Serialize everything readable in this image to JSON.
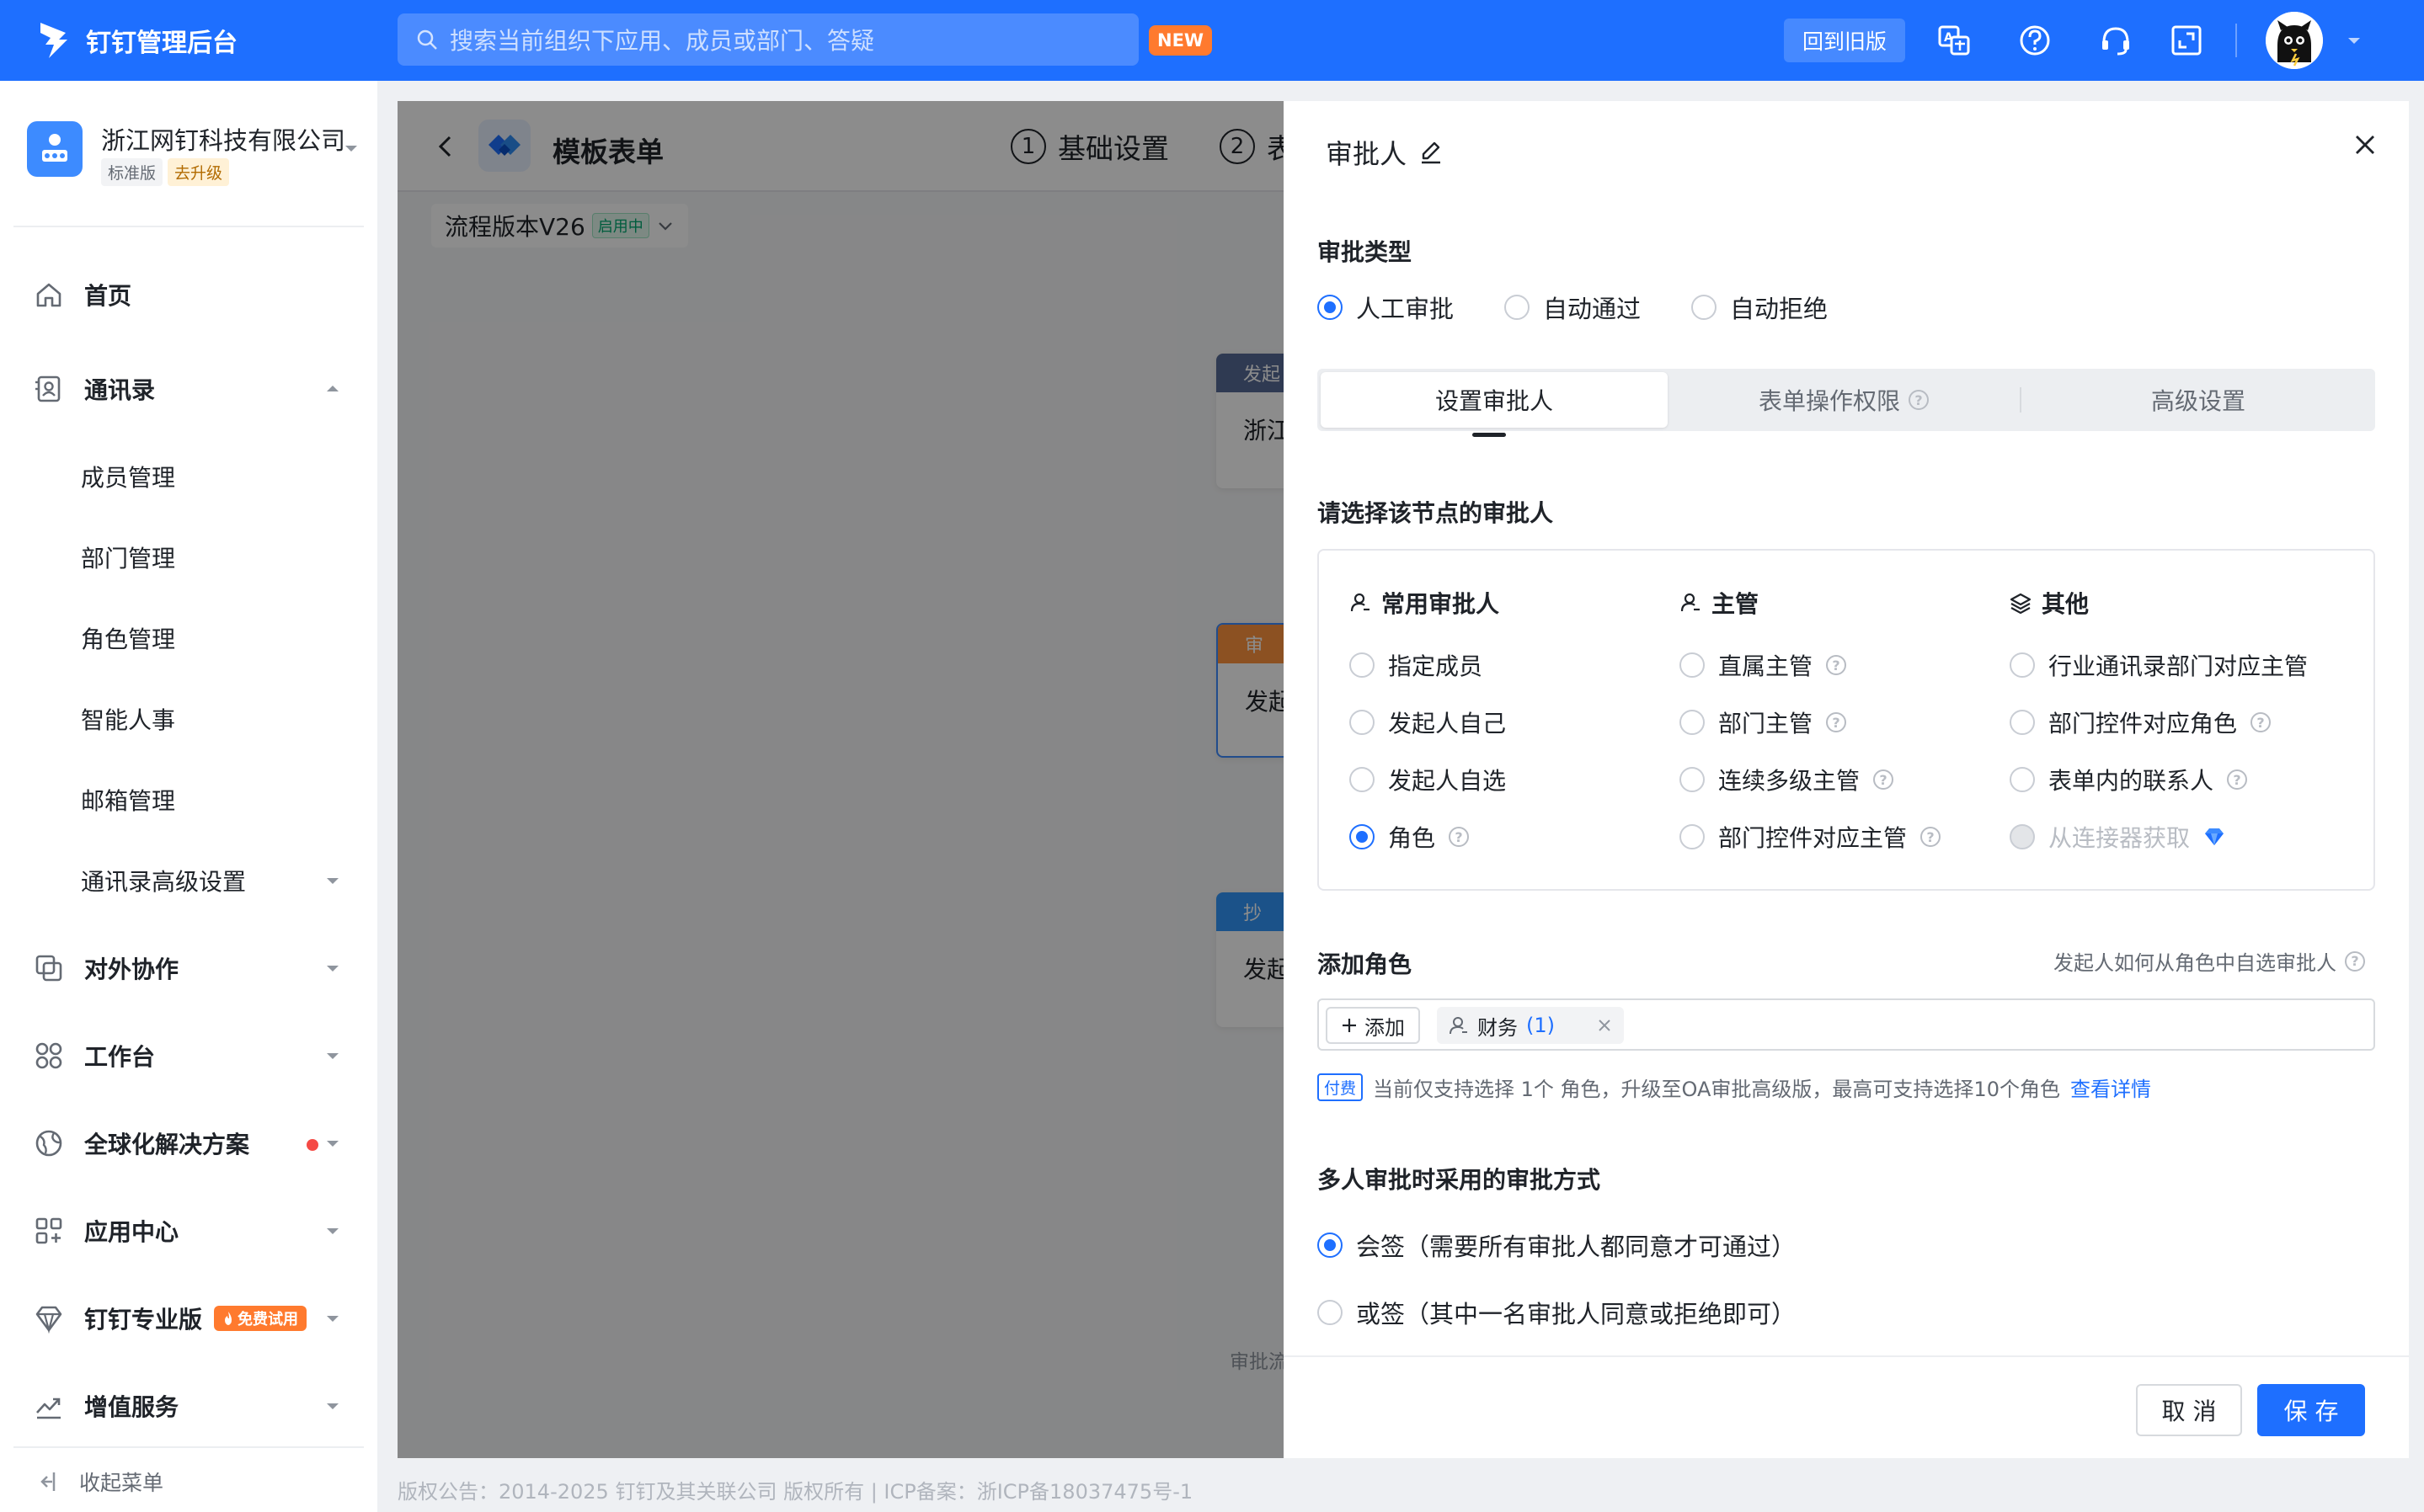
{
  "topbar": {
    "app_title": "钉钉管理后台",
    "search_placeholder": "搜索当前组织下应用、成员或部门、答疑",
    "new_badge": "NEW",
    "old_version_label": "回到旧版",
    "icons": [
      "translate-icon",
      "help-icon",
      "customer-service-icon",
      "fullscreen-icon"
    ],
    "brand_color": "#1e6fff"
  },
  "sidebar": {
    "org_name": "浙江网钉科技有限公司",
    "org_plan": "标准版",
    "org_upgrade": "去升级",
    "items": [
      {
        "label": "首页",
        "icon": "home-icon"
      },
      {
        "label": "通讯录",
        "icon": "contacts-icon",
        "expanded": true
      },
      {
        "label": "对外协作",
        "icon": "collaboration-icon"
      },
      {
        "label": "工作台",
        "icon": "workbench-icon"
      },
      {
        "label": "全球化解决方案",
        "icon": "globe-icon",
        "dot": true
      },
      {
        "label": "应用中心",
        "icon": "apps-icon"
      },
      {
        "label": "钉钉专业版",
        "icon": "diamond-icon",
        "badge": "免费试用"
      },
      {
        "label": "增值服务",
        "icon": "chart-icon"
      }
    ],
    "subitems": [
      "成员管理",
      "部门管理",
      "角色管理",
      "智能人事",
      "邮箱管理",
      "通讯录高级设置"
    ],
    "collapse_label": "收起菜单"
  },
  "page": {
    "title": "模板表单",
    "steps": [
      {
        "num": "1",
        "label": "基础设置"
      },
      {
        "num": "2",
        "label": "表"
      }
    ],
    "version_label": "流程版本V26",
    "version_status": "启用中",
    "flow_cards": [
      {
        "head": "发起",
        "body": "浙江"
      },
      {
        "head": "审",
        "body": "发起"
      },
      {
        "head": "抄",
        "body": "发起"
      }
    ],
    "flow_note": "审批流",
    "footer": "版权公告：2014-2025 钉钉及其关联公司 版权所有 | ICP备案：浙ICP备18037475号-1"
  },
  "drawer": {
    "title": "审批人",
    "approval_type_label": "审批类型",
    "approval_types": [
      {
        "label": "人工审批",
        "selected": true
      },
      {
        "label": "自动通过",
        "selected": false
      },
      {
        "label": "自动拒绝",
        "selected": false
      }
    ],
    "tabs": [
      {
        "label": "设置审批人",
        "active": true
      },
      {
        "label": "表单操作权限",
        "help": true
      },
      {
        "label": "高级设置"
      }
    ],
    "choose_label": "请选择该节点的审批人",
    "columns": [
      {
        "title": "常用审批人",
        "icon": "user-icon",
        "options": [
          {
            "label": "指定成员",
            "selected": false,
            "help": false
          },
          {
            "label": "发起人自己",
            "selected": false,
            "help": false
          },
          {
            "label": "发起人自选",
            "selected": false,
            "help": false
          },
          {
            "label": "角色",
            "selected": true,
            "help": true
          }
        ]
      },
      {
        "title": "主管",
        "icon": "user-icon",
        "options": [
          {
            "label": "直属主管",
            "selected": false,
            "help": true
          },
          {
            "label": "部门主管",
            "selected": false,
            "help": true
          },
          {
            "label": "连续多级主管",
            "selected": false,
            "help": true
          },
          {
            "label": "部门控件对应主管",
            "selected": false,
            "help": true
          }
        ]
      },
      {
        "title": "其他",
        "icon": "layers-icon",
        "options": [
          {
            "label": "行业通讯录部门对应主管",
            "selected": false,
            "help": false
          },
          {
            "label": "部门控件对应角色",
            "selected": false,
            "help": true
          },
          {
            "label": "表单内的联系人",
            "selected": false,
            "help": true
          },
          {
            "label": "从连接器获取",
            "selected": false,
            "disabled": true,
            "diamond": true
          }
        ]
      }
    ],
    "add_role_label": "添加角色",
    "add_role_help": "发起人如何从角色中自选审批人",
    "add_button": "添加",
    "role_tag": {
      "name": "财务",
      "count": "(1)"
    },
    "pay_badge": "付费",
    "pay_note": "当前仅支持选择 1个 角色，升级至OA审批高级版，最高可支持选择10个角色",
    "pay_link": "查看详情",
    "multi_label": "多人审批时采用的审批方式",
    "multi_options": [
      {
        "label": "会签（需要所有审批人都同意才可通过）",
        "selected": true
      },
      {
        "label": "或签（其中一名审批人同意或拒绝即可）",
        "selected": false
      }
    ],
    "cancel_label": "取 消",
    "save_label": "保 存"
  }
}
